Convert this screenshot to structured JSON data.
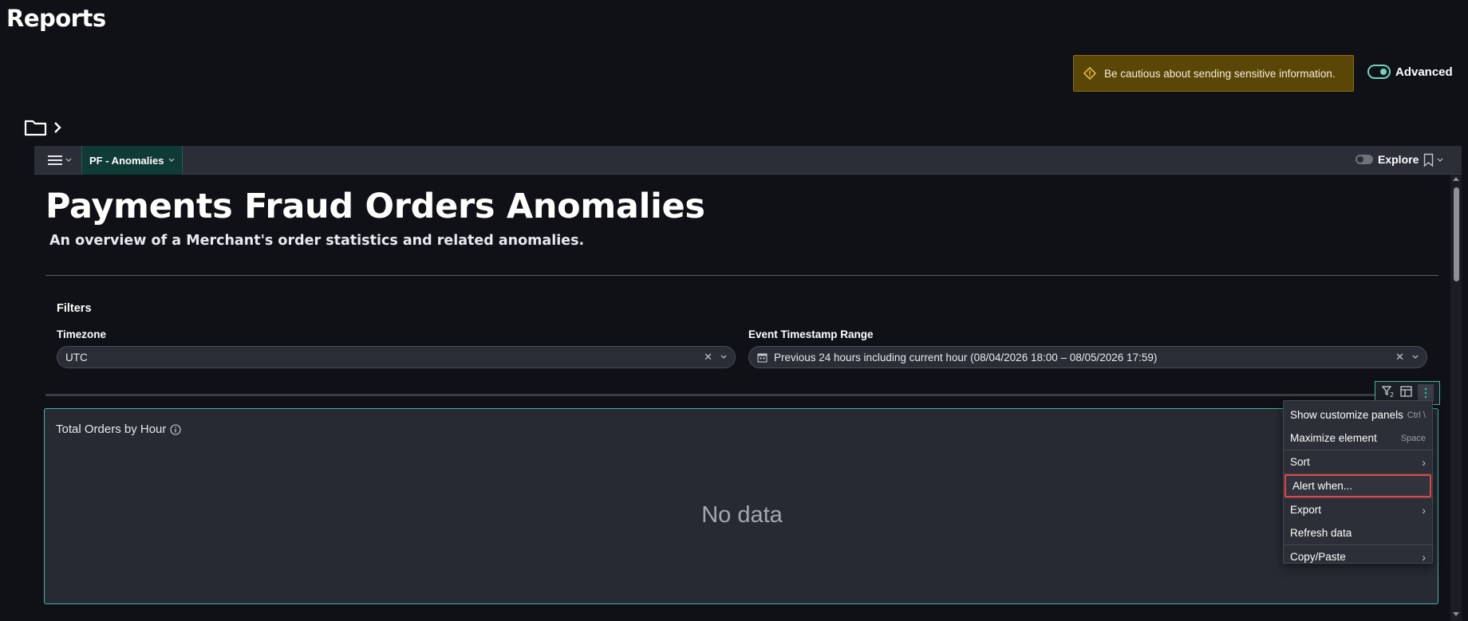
{
  "page": {
    "title": "Reports"
  },
  "banner": {
    "text": "Be cautious about sending sensitive information."
  },
  "advanced": {
    "label": "Advanced"
  },
  "toolbar": {
    "dashboard_tab": "PF - Anomalies",
    "explore_label": "Explore"
  },
  "dashboard": {
    "title": "Payments Fraud Orders Anomalies",
    "subtitle": "An overview of a Merchant's order statistics and related anomalies."
  },
  "filters": {
    "heading": "Filters",
    "timezone": {
      "label": "Timezone",
      "value": "UTC"
    },
    "range": {
      "label": "Event Timestamp Range",
      "value": "Previous 24 hours including current hour (08/04/2026 18:00 – 08/05/2026 17:59)"
    }
  },
  "panel": {
    "title": "Total Orders by Hour",
    "empty_text": "No data"
  },
  "context_menu": {
    "items": [
      {
        "label": "Show customize panels",
        "shortcut": "Ctrl \\"
      },
      {
        "label": "Maximize element",
        "shortcut": "Space"
      },
      {
        "label": "Sort",
        "shortcut": "›"
      },
      {
        "label": "Alert when...",
        "shortcut": ""
      },
      {
        "label": "Export",
        "shortcut": "›"
      },
      {
        "label": "Refresh data",
        "shortcut": ""
      },
      {
        "label": "Copy/Paste",
        "shortcut": "›"
      }
    ]
  },
  "colors": {
    "background": "#101116",
    "accent": "#3bb6a3",
    "warning_bg": "#5a4708",
    "highlight_border": "#e24545"
  },
  "icons": [
    "warning-icon",
    "folder-icon",
    "chevron-right-icon",
    "hamburger-menu-icon",
    "chevron-down-icon",
    "bookmark-icon",
    "calendar-icon",
    "clear-icon",
    "info-icon",
    "filter-icon",
    "table-icon",
    "more-vertical-icon"
  ]
}
